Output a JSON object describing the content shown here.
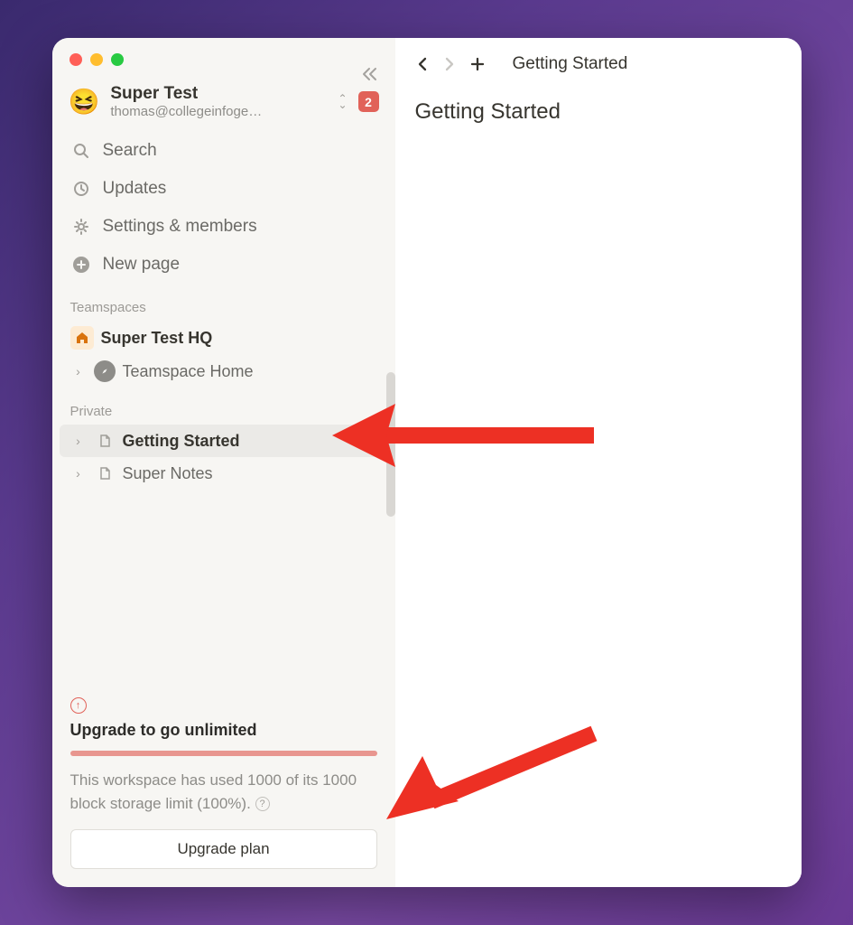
{
  "workspace": {
    "emoji": "😆",
    "name": "Super Test",
    "email": "thomas@collegeinfoge…",
    "notification_count": "2"
  },
  "sidebar_menu": {
    "search": "Search",
    "updates": "Updates",
    "settings": "Settings & members",
    "new_page": "New page"
  },
  "sections": {
    "teamspaces_label": "Teamspaces",
    "private_label": "Private"
  },
  "teamspaces": {
    "hq": {
      "icon": "🏠",
      "label": "Super Test HQ"
    },
    "home": {
      "label": "Teamspace Home"
    }
  },
  "private_pages": {
    "getting_started": {
      "label": "Getting Started"
    },
    "super_notes": {
      "label": "Super Notes"
    }
  },
  "upgrade": {
    "title": "Upgrade to go unlimited",
    "text": "This workspace has used 1000 of its 1000 block storage limit (100%).",
    "button": "Upgrade plan"
  },
  "page": {
    "breadcrumb": "Getting Started",
    "title": "Getting Started"
  },
  "colors": {
    "accent_red": "#e16259",
    "sidebar_bg": "#f7f6f3"
  }
}
